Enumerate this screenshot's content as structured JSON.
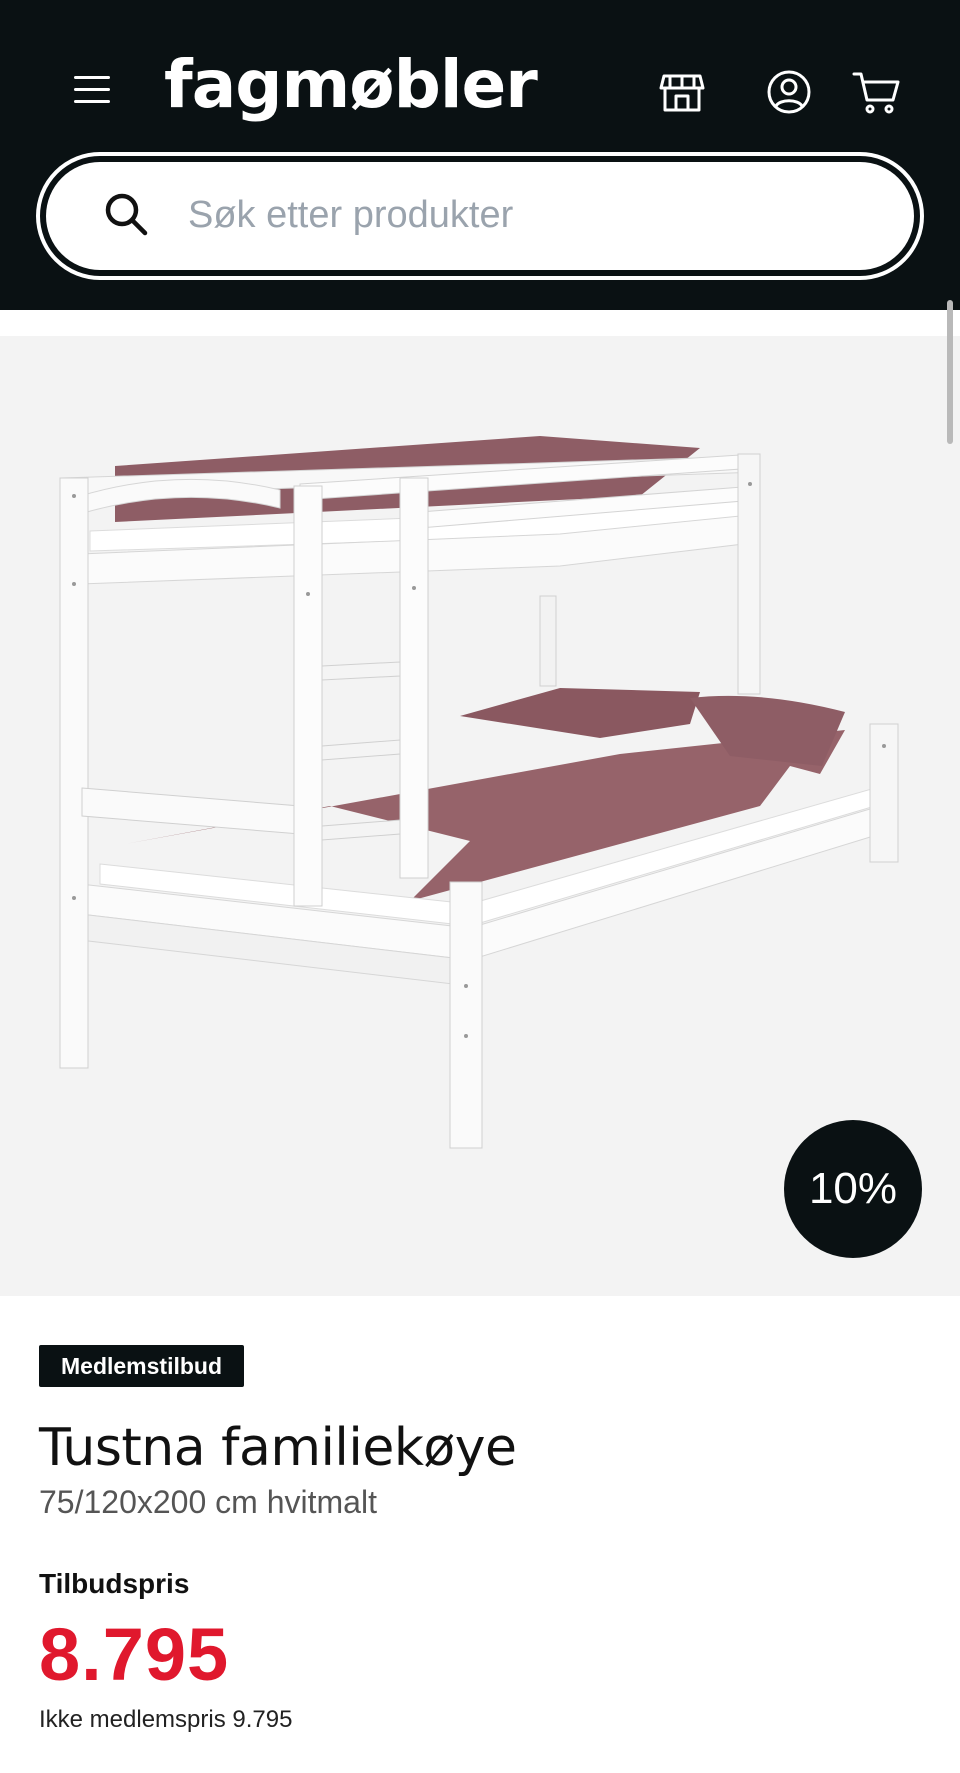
{
  "header": {
    "logo": "fagmøbler",
    "icons": [
      "menu-icon",
      "store-icon",
      "account-icon",
      "cart-icon"
    ]
  },
  "search": {
    "placeholder": "Søk etter produkter"
  },
  "product": {
    "discount_badge": "10%",
    "offer_badge": "Medlemstilbud",
    "title": "Tustna familiekøye",
    "subtitle": "75/120x200 cm hvitmalt",
    "price_label": "Tilbudspris",
    "price": "8.795",
    "non_member_price": "Ikke medlemspris 9.795"
  },
  "colors": {
    "header_bg": "#0a1113",
    "price_red": "#e0182d",
    "image_bg": "#f3f3f3"
  }
}
